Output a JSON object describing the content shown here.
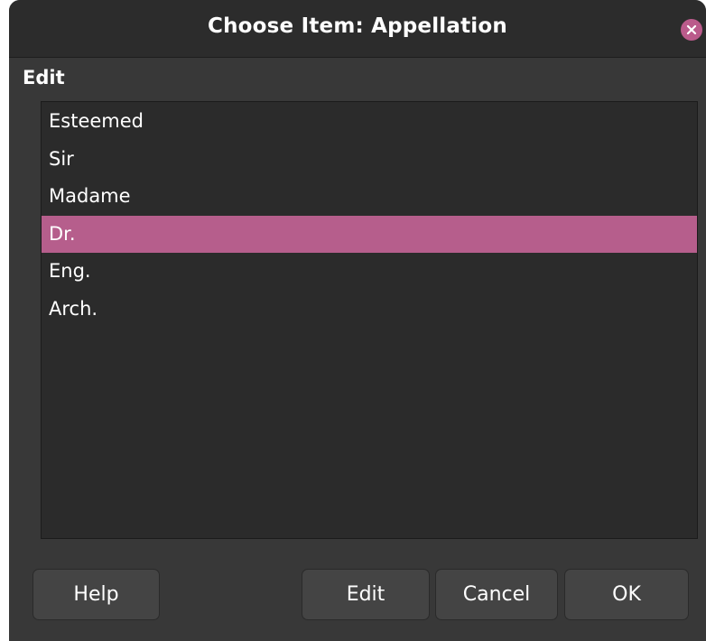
{
  "window": {
    "title": "Choose Item: Appellation",
    "accent_color": "#b65e8c"
  },
  "section": {
    "label": "Edit"
  },
  "list": {
    "items": [
      {
        "label": "Esteemed",
        "selected": false
      },
      {
        "label": "Sir",
        "selected": false
      },
      {
        "label": "Madame",
        "selected": false
      },
      {
        "label": "Dr.",
        "selected": true
      },
      {
        "label": "Eng.",
        "selected": false
      },
      {
        "label": "Arch.",
        "selected": false
      }
    ]
  },
  "buttons": {
    "help": "Help",
    "edit": "Edit",
    "cancel": "Cancel",
    "ok": "OK"
  },
  "icons": {
    "close": "close-icon"
  }
}
